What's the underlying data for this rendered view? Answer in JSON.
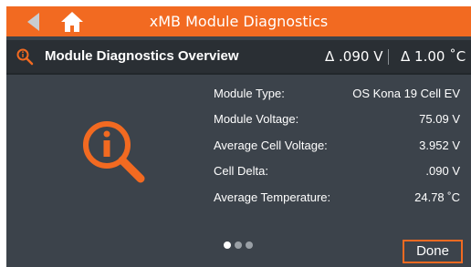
{
  "app": {
    "title": "xMB Module Diagnostics",
    "accent_color": "#f26a21",
    "background_color": "#3c434b",
    "icons": {
      "back": "back-arrow-icon",
      "home": "home-icon",
      "header": "magnifier-info-icon"
    }
  },
  "header": {
    "title": "Module Diagnostics Overview",
    "delta_voltage": "Δ .090 V",
    "delta_temperature": "Δ 1.00 ˚C"
  },
  "details": [
    {
      "label": "Module Type:",
      "value": "OS Kona 19 Cell EV"
    },
    {
      "label": "Module Voltage:",
      "value": "75.09 V"
    },
    {
      "label": "Average Cell Voltage:",
      "value": "3.952 V"
    },
    {
      "label": "Cell Delta:",
      "value": ".090 V"
    },
    {
      "label": "Average Temperature:",
      "value": "24.78 ˚C"
    }
  ],
  "pagination": {
    "pages": 3,
    "current": 1
  },
  "footer": {
    "done_label": "Done"
  }
}
